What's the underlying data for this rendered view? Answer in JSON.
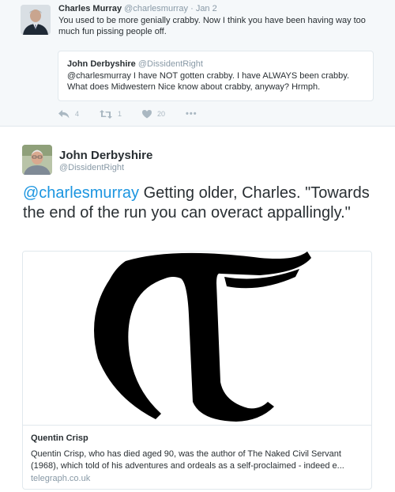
{
  "parent_tweet": {
    "author_name": "Charles Murray",
    "author_handle": "@charlesmurray",
    "separator": "·",
    "date": "Jan 2",
    "text": "You used to be more genially crabby. Now I think you have been having way too much fun pissing people off.",
    "quoted": {
      "author_name": "John Derbyshire",
      "author_handle": "@DissidentRight",
      "text": "@charlesmurray I have NOT gotten crabby.  I have ALWAYS been crabby.  What does Midwestern Nice know about crabby, anyway?  Hrmph."
    },
    "actions": {
      "reply_icon": "reply-icon",
      "reply_count": "4",
      "retweet_icon": "retweet-icon",
      "retweet_count": "1",
      "like_icon": "heart-icon",
      "like_count": "20",
      "more_label": "•••"
    }
  },
  "main_tweet": {
    "author_name": "John Derbyshire",
    "author_handle": "@DissidentRight",
    "mention": "@charlesmurray",
    "text": " Getting older, Charles. \"Towards the end of the run you can overact appallingly.\"",
    "card": {
      "image_icon": "telegraph-logo",
      "title": "Quentin Crisp",
      "description": "Quentin Crisp, who has died aged 90, was the author of The Naked Civil Servant (1968), which told of his adventures and ordeals as a self-proclaimed - indeed e...",
      "domain": "telegraph.co.uk"
    }
  },
  "colors": {
    "link": "#1b95e0",
    "muted": "#8899a6",
    "text": "#292f33",
    "border": "#e1e8ed",
    "parent_bg": "#f5f8fa"
  }
}
